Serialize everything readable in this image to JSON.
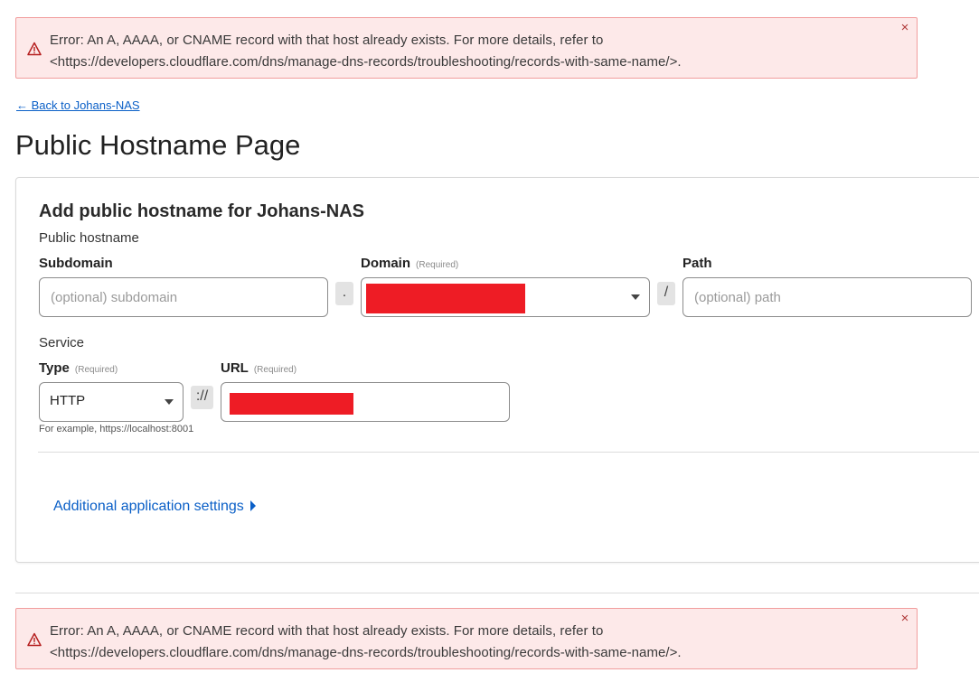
{
  "error": {
    "line1": "Error: An A, AAAA, or CNAME record with that host already exists. For more details, refer to",
    "line2": "<https://developers.cloudflare.com/dns/manage-dns-records/troubleshooting/records-with-same-name/>.",
    "close_glyph": "×",
    "icon": "warning-triangle-icon"
  },
  "nav": {
    "back_link": "← Back to Johans-NAS"
  },
  "page": {
    "title": "Public Hostname Page"
  },
  "form": {
    "title": "Add public hostname for Johans-NAS",
    "public_hostname_label": "Public hostname",
    "subdomain": {
      "label": "Subdomain",
      "placeholder": "(optional) subdomain",
      "value": ""
    },
    "dot_separator": ".",
    "domain": {
      "label": "Domain",
      "required": "(Required)",
      "value": "[redacted]"
    },
    "slash_separator": "/",
    "path": {
      "label": "Path",
      "placeholder": "(optional) path",
      "value": ""
    },
    "service_label": "Service",
    "type": {
      "label": "Type",
      "required": "(Required)",
      "value": "HTTP"
    },
    "scheme_separator": "://",
    "url": {
      "label": "URL",
      "required": "(Required)",
      "value": "[redacted]"
    },
    "url_hint": "For example, https://localhost:8001",
    "additional_settings": "Additional application settings"
  },
  "colors": {
    "error_bg": "#fde9e9",
    "error_border": "#f19d9d",
    "link": "#0a5fc7",
    "redaction": "#ee1c25"
  }
}
